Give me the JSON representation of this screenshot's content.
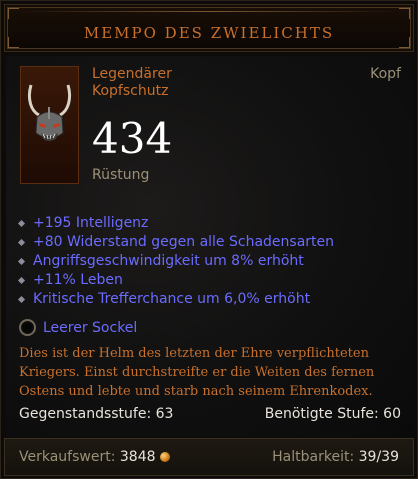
{
  "item": {
    "name": "MEMPO DES ZWIELICHTS",
    "type_line_1": "Legendärer",
    "type_line_2": "Kopfschutz",
    "slot": "Kopf",
    "armor_value": "434",
    "armor_label": "Rüstung",
    "stats": [
      "+195 Intelligenz",
      "+80 Widerstand gegen alle Schadensarten",
      "Angriffsgeschwindigkeit um 8% erhöht",
      "+11% Leben",
      "Kritische Trefferchance um 6,0% erhöht"
    ],
    "socket_label": "Leerer Sockel",
    "flavor_lines": [
      "Dies ist der Helm des letzten der Ehre verpflichteten",
      "Kriegers. Einst durchstreifte er die Weiten des fernen",
      "Ostens und lebte und starb nach seinem Ehrenkodex."
    ],
    "item_level": "Gegenstandsstufe: 63",
    "required_level": "Benötigte Stufe: 60",
    "sell_label": "Verkaufswert:",
    "sell_value": "3848",
    "durability_label": "Haltbarkeit:",
    "durability_value": "39/39"
  },
  "colors": {
    "legendary": "#c8702c",
    "magic": "#6b6bff",
    "muted": "#9b9078",
    "white": "#e8e4dc"
  },
  "icons": {
    "item": "helm-mask-icon",
    "socket": "empty-socket-icon",
    "currency": "gold-coin-icon",
    "bullet": "diamond-bullet-icon"
  }
}
